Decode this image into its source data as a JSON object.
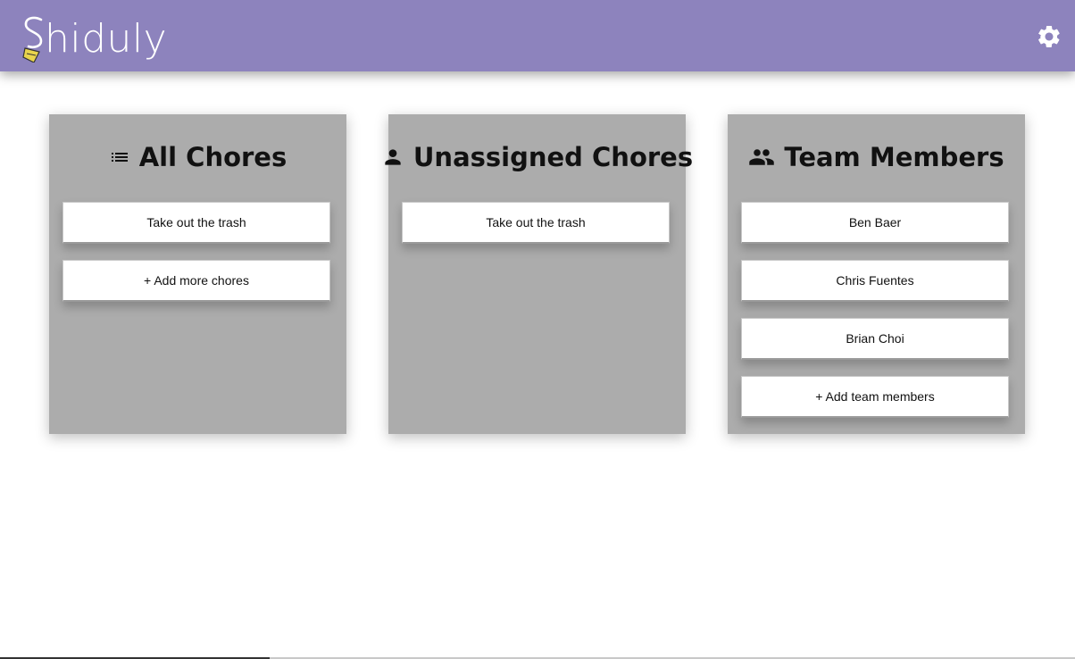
{
  "header": {
    "logo_text": "hiduly",
    "background": "#8d83bd",
    "settings_icon": "gear-icon"
  },
  "columns": [
    {
      "title": "All Chores",
      "icon": "list-icon",
      "cards": [
        "Take out the trash",
        "+ Add more chores"
      ]
    },
    {
      "title": "Unassigned Chores",
      "icon": "person-icon",
      "cards": [
        "Take out the trash"
      ]
    },
    {
      "title": "Team Members",
      "icon": "group-icon",
      "cards": [
        "Ben Baer",
        "Chris Fuentes",
        "Brian Choi",
        "+ Add team members"
      ]
    }
  ]
}
